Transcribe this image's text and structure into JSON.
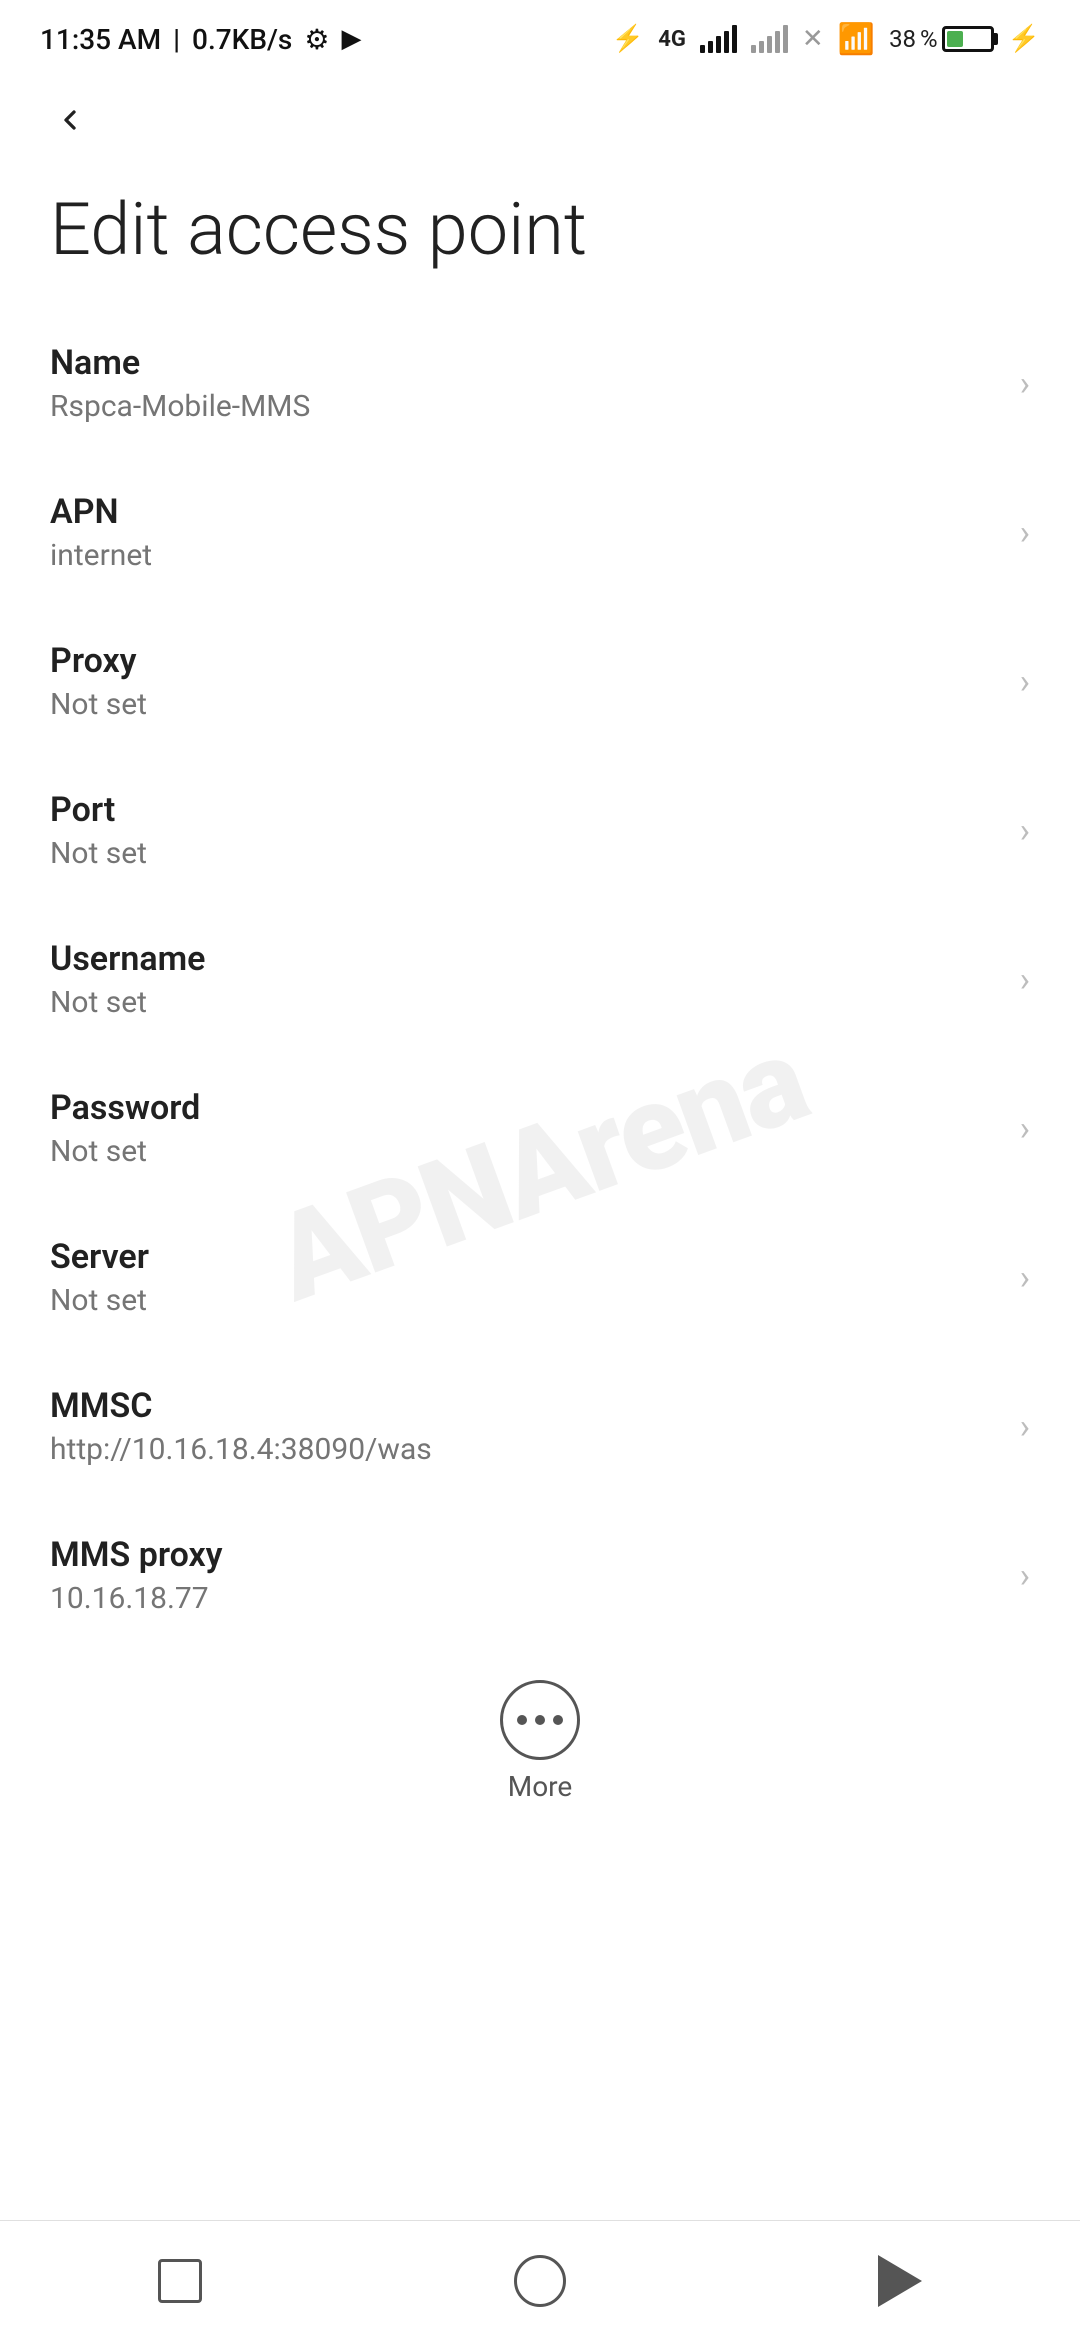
{
  "statusBar": {
    "time": "11:35 AM",
    "speed": "0.7KB/s",
    "battery": 38
  },
  "toolbar": {
    "backLabel": "←"
  },
  "pageTitle": "Edit access point",
  "settings": [
    {
      "id": "name",
      "title": "Name",
      "value": "Rspca-Mobile-MMS"
    },
    {
      "id": "apn",
      "title": "APN",
      "value": "internet"
    },
    {
      "id": "proxy",
      "title": "Proxy",
      "value": "Not set"
    },
    {
      "id": "port",
      "title": "Port",
      "value": "Not set"
    },
    {
      "id": "username",
      "title": "Username",
      "value": "Not set"
    },
    {
      "id": "password",
      "title": "Password",
      "value": "Not set"
    },
    {
      "id": "server",
      "title": "Server",
      "value": "Not set"
    },
    {
      "id": "mmsc",
      "title": "MMSC",
      "value": "http://10.16.18.4:38090/was"
    },
    {
      "id": "mms-proxy",
      "title": "MMS proxy",
      "value": "10.16.18.77"
    }
  ],
  "more": {
    "label": "More"
  },
  "watermark": "APNArena"
}
